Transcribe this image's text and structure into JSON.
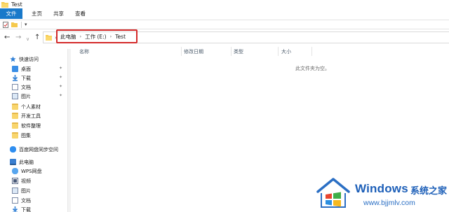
{
  "window": {
    "title": "Test"
  },
  "ribbon": {
    "tabs": [
      "文件",
      "主页",
      "共享",
      "查看"
    ]
  },
  "qat": {
    "dropdown_glyph": "▾"
  },
  "nav": {
    "back": "←",
    "forward": "→",
    "recent": "∨",
    "up": "↑"
  },
  "address": {
    "crumbs": [
      "此电脑",
      "工作 (E:)",
      "Test"
    ],
    "separator": "›"
  },
  "sidebar": {
    "quick_access": "快速访问",
    "items": [
      {
        "label": "桌面",
        "icon": "desktop-icon",
        "pinned": true
      },
      {
        "label": "下载",
        "icon": "download-icon",
        "pinned": true
      },
      {
        "label": "文档",
        "icon": "document-icon",
        "pinned": true
      },
      {
        "label": "图片",
        "icon": "picture-icon",
        "pinned": true
      },
      {
        "label": "个人素材",
        "icon": "folder-icon",
        "pinned": false
      },
      {
        "label": "开发工具",
        "icon": "folder-icon",
        "pinned": false
      },
      {
        "label": "软件整理",
        "icon": "folder-icon",
        "pinned": false
      },
      {
        "label": "图集",
        "icon": "folder-icon",
        "pinned": false
      }
    ],
    "baidu": "百度网盘同步空间",
    "this_pc": "此电脑",
    "pc_items": [
      {
        "label": "WPS网盘",
        "icon": "cloud-icon"
      },
      {
        "label": "视频",
        "icon": "video-icon"
      },
      {
        "label": "图片",
        "icon": "picture-icon"
      },
      {
        "label": "文档",
        "icon": "document-icon"
      },
      {
        "label": "下载",
        "icon": "download-icon"
      }
    ]
  },
  "columns": {
    "name": "名称",
    "modified": "修改日期",
    "type": "类型",
    "size": "大小"
  },
  "content": {
    "empty_message": "此文件夹为空。"
  },
  "watermark": {
    "brand": "Windows",
    "brand_cn": "系统之家",
    "url": "www.bjjmlv.com"
  },
  "colors": {
    "accent": "#1979ca",
    "highlight_border": "#d42a2a",
    "watermark_blue": "#1d5fb8"
  }
}
